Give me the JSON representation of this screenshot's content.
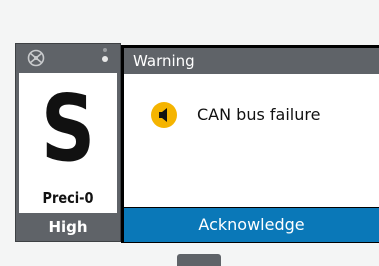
{
  "mode_panel": {
    "letter": "S",
    "name": "Preci-0",
    "level": "High",
    "icons": [
      "steering-wheel-icon",
      "dot-icon"
    ]
  },
  "warning_dialog": {
    "title": "Warning",
    "icon": "speaker-alarm-icon",
    "message": "CAN bus failure",
    "ack_label": "Acknowledge"
  },
  "colors": {
    "panel_gray": "#5f6368",
    "accent_blue": "#0a78b8",
    "alarm_yellow": "#f5b400"
  }
}
